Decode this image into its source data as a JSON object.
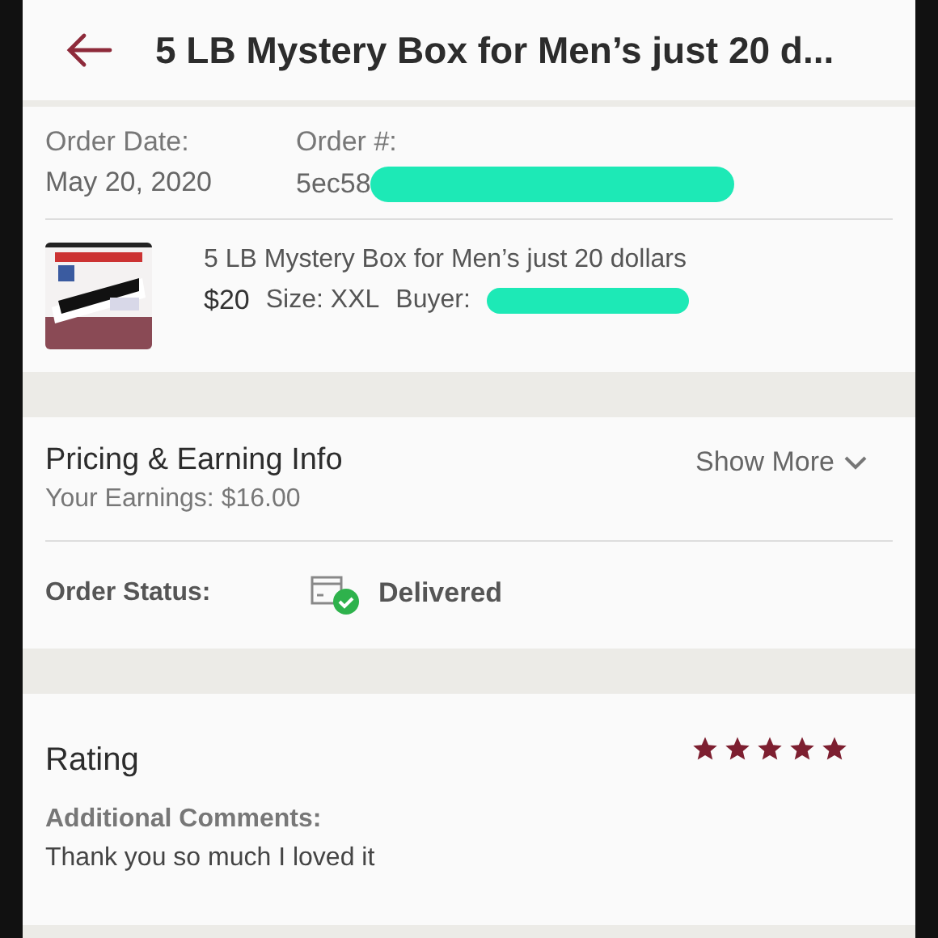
{
  "header": {
    "title": "5 LB Mystery Box for Men’s just 20 d..."
  },
  "order": {
    "date_label": "Order Date:",
    "date": "May 20, 2020",
    "number_label": "Order #:",
    "number": "5ec58"
  },
  "item": {
    "kind": "picture",
    "title": "5 LB Mystery Box for Men’s just 20 dollars",
    "price": "$20",
    "size": "Size: XXL",
    "buyer_label": "Buyer:"
  },
  "pricing": {
    "title": "Pricing & Earning Info",
    "earnings": "Your Earnings: $16.00",
    "show_more": "Show More"
  },
  "status": {
    "label": "Order Status:",
    "value": "Delivered"
  },
  "rating": {
    "title": "Rating",
    "stars": 5,
    "comments_label": "Additional Comments:",
    "comment": "Thank you so much I loved it"
  }
}
